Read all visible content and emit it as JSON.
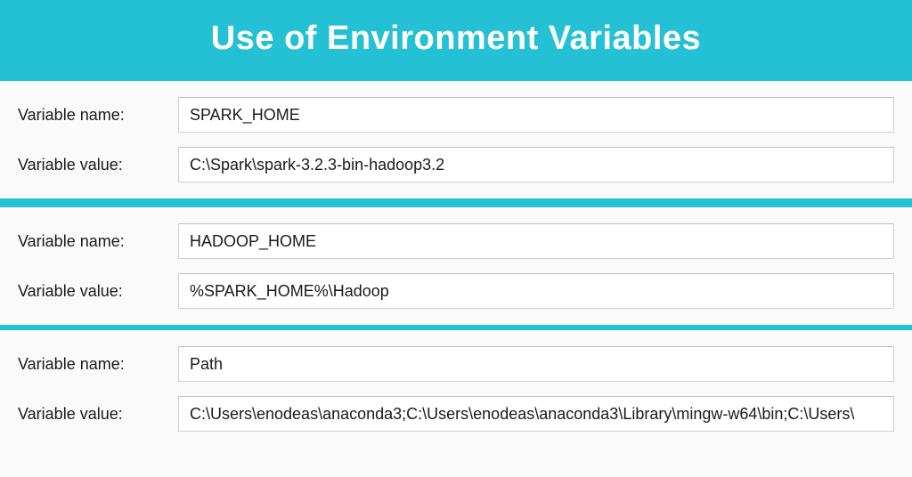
{
  "header": {
    "title": "Use of Environment Variables"
  },
  "labels": {
    "variable_name": "Variable name:",
    "variable_value": "Variable value:"
  },
  "entries": [
    {
      "name": "SPARK_HOME",
      "value": "C:\\Spark\\spark-3.2.3-bin-hadoop3.2"
    },
    {
      "name": "HADOOP_HOME",
      "value": "%SPARK_HOME%\\Hadoop"
    },
    {
      "name": "Path",
      "value": "C:\\Users\\enodeas\\anaconda3;C:\\Users\\enodeas\\anaconda3\\Library\\mingw-w64\\bin;C:\\Users\\"
    }
  ]
}
